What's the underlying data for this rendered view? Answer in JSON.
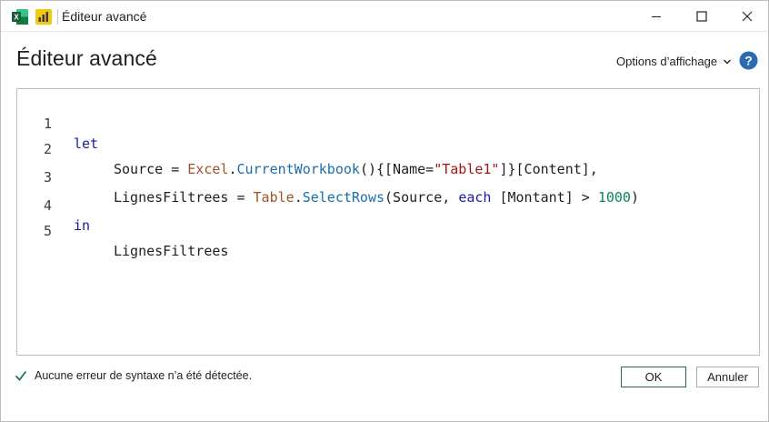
{
  "window": {
    "title": "Éditeur avancé",
    "icons": [
      "excel-icon",
      "power-bi-icon"
    ],
    "controls": [
      "minimize-icon",
      "maximize-icon",
      "close-icon"
    ]
  },
  "header": {
    "title": "Éditeur avancé",
    "view_options_label": "Options d’affichage",
    "help_icon": "help-icon"
  },
  "editor": {
    "lines": [
      {
        "number": "1",
        "tokens": {
          "kw": "let"
        }
      },
      {
        "number": "2",
        "tokens": {
          "var": "Source",
          "eq": " = ",
          "lib": "Excel",
          "dot": ".",
          "fn": "CurrentWorkbook",
          "p1": "(){[Name=",
          "str": "\"Table1\"",
          "p2": "]}[Content],"
        }
      },
      {
        "number": "3",
        "tokens": {
          "var": "LignesFiltrees",
          "eq": " = ",
          "lib": "Table",
          "dot": ".",
          "fn": "SelectRows",
          "p1": "(Source, ",
          "kw": "each",
          "p2": " [Montant] > ",
          "num": "1000",
          "p3": ")"
        }
      },
      {
        "number": "4",
        "tokens": {
          "kw": "in"
        }
      },
      {
        "number": "5",
        "tokens": {
          "var": "LignesFiltrees"
        }
      }
    ]
  },
  "footer": {
    "status_text": "Aucune erreur de syntaxe n’a été détectée.",
    "ok_label": "OK",
    "cancel_label": "Annuler"
  },
  "colors": {
    "accent": "#217346",
    "keyword": "#1a1aa6",
    "string": "#a31515",
    "number": "#098658",
    "help": "#2b6cb0"
  }
}
